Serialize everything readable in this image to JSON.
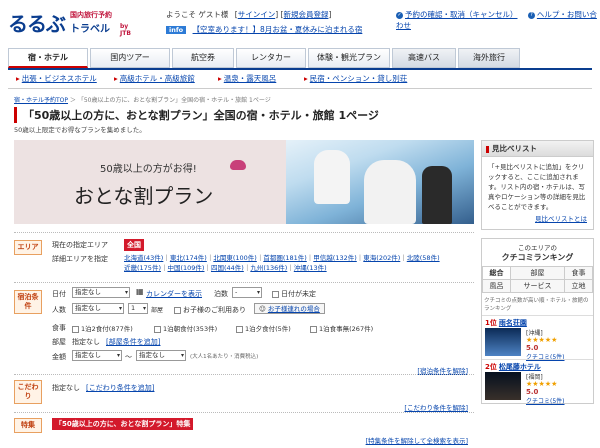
{
  "header": {
    "logo_main": "るるぶ",
    "logo_sub1": "国内旅行予約",
    "logo_sub2": "トラベル",
    "logo_jtb": "by JTB",
    "welcome": "ようこそ ゲスト様",
    "signin": "サインイン",
    "register": "新規会員登録",
    "top_links": [
      "予約の確認・取消（キャンセル）",
      "ヘルプ・お問い合わせ"
    ],
    "info_tag": "info",
    "info_message": "【空室あります！】8月お盆・夏休みに泊まれる宿"
  },
  "nav": {
    "tabs": [
      "宿・ホテル",
      "国内ツアー",
      "航空券",
      "レンタカー",
      "体験・観光プラン",
      "高速バス",
      "海外旅行"
    ],
    "subnav": [
      "出張・ビジネスホテル",
      "高級ホテル・高級旅館",
      "温泉・露天風呂",
      "民宿・ペンション・貸し別荘"
    ]
  },
  "breadcrumb": [
    "宿・ホテル予約TOP",
    "「50歳以上の方に、おとな割プラン」全国の宿・ホテル・旅館 1ページ"
  ],
  "page": {
    "title": "「50歳以上の方に、おとな割プラン」全国の宿・ホテル・旅館 1ページ",
    "subtitle": "50歳以上限定でお得なプランを集めました。"
  },
  "banner": {
    "line1": "50歳以上の方がお得!",
    "line2": "おとな割プラン"
  },
  "sidebar": {
    "viewed_title": "見比べリスト",
    "viewed_text": "「+見比べリストに追加」をクリックすると、ここに追加されます。リスト内の宿・ホテルは、写真やロケーション等の詳細を見比べることができます。",
    "viewed_more": "見比べリストとは",
    "rank_caption": "このエリアの",
    "rank_title": "クチコミランキング",
    "rank_tabs": [
      [
        "総合",
        "部屋",
        "食事"
      ],
      [
        "風呂",
        "サービス",
        "立地"
      ]
    ],
    "rank_note": "クチコミの点数が高い順・ホテル・旅館のランキング",
    "items": [
      {
        "no": "1位",
        "name": "雨名荘園",
        "area": "[沖縄]",
        "stars": "★★★★★",
        "score": "5.0",
        "reviews": "クチコミ(5件)"
      },
      {
        "no": "2位",
        "name": "松尾藤ホテル",
        "area": "[福岡]",
        "stars": "★★★★★",
        "score": "5.0",
        "reviews": "クチコミ(5件)"
      }
    ]
  },
  "search": {
    "area_label": "エリア",
    "current_area_label": "現在の指定エリア",
    "current_area_value": "全国",
    "detail_area_label": "詳細エリアを指定",
    "areas_line1": [
      "北海道(43件)",
      "東北(174件)",
      "北関東(100件)",
      "首都圏(181件)",
      "甲信越(132件)",
      "東海(202件)",
      "北陸(58件)"
    ],
    "areas_line2": [
      "近畿(175件)",
      "中国(109件)",
      "四国(44件)",
      "九州(136件)",
      "沖縄(13件)"
    ],
    "stay_label": "宿泊条件",
    "date_label": "日付",
    "date_value": "指定なし",
    "calendar_link": "カレンダーを表示",
    "nights_label": "泊数",
    "nights_value": "-",
    "undecided": "日付が未定",
    "people_label": "人数",
    "people_value": "指定なし",
    "rooms_value": "1",
    "rooms_unit": "部屋",
    "child_option": "お子様のご利用あり",
    "room_types_link": "お子様連れの場合",
    "meal_label": "食事",
    "meals": [
      "1泊2食付(877件)",
      "1泊朝食付(353件)",
      "1泊夕食付(5件)",
      "1泊食事無(267件)"
    ],
    "room_label": "部屋",
    "room_value": "指定なし",
    "room_link": "[部屋条件を追加]",
    "price_label": "金額",
    "price_from": "指定なし",
    "price_to": "指定なし",
    "price_note": "(大人1名あたり・消費税込)",
    "clear_stay": "[宿泊条件を解除]",
    "more_label": "こだわり",
    "more_value": "指定なし",
    "more_link": "[こだわり条件を追加]",
    "clear_more": "[こだわり条件を解除]",
    "special_label": "特集",
    "special_value": "「50歳以上の方に、おとな割プラン」特集",
    "clear_special": "[特集条件を解除して全検索を表示]"
  }
}
